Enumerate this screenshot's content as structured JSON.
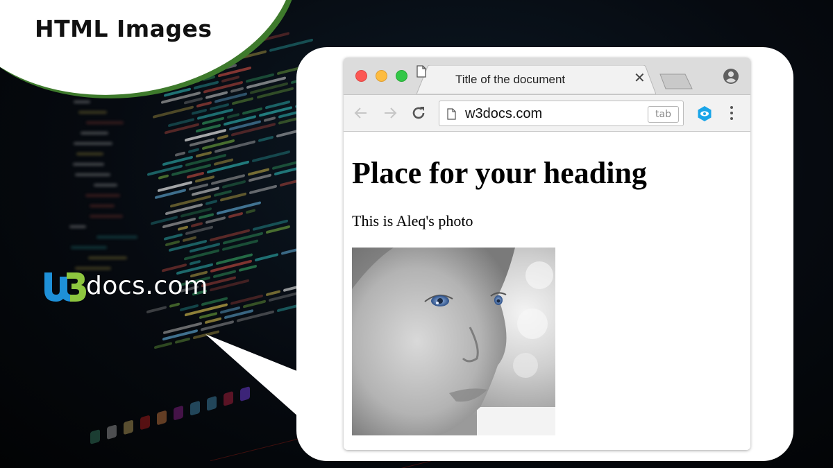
{
  "banner": {
    "title": "HTML Images",
    "accent_green": "#3e7a2c"
  },
  "logo": {
    "brand_mark": "W3",
    "text": "docs.com",
    "blue": "#1e90d8",
    "green": "#8dc63f"
  },
  "browser": {
    "tab": {
      "title": "Title of the document",
      "close_icon": "close-icon",
      "page_icon": "document-icon"
    },
    "toolbar": {
      "back_icon": "arrow-left-icon",
      "forward_icon": "arrow-right-icon",
      "reload_icon": "reload-icon",
      "url": "w3docs.com",
      "url_hint": "tab",
      "extension_icon": "eye-hexagon-icon",
      "menu_icon": "kebab-menu-icon",
      "profile_icon": "account-circle-icon"
    },
    "content": {
      "heading": "Place for your heading",
      "paragraph": "This is Aleq's photo",
      "image_alt": "Black and white close-up photo of a baby with blue eyes"
    }
  }
}
